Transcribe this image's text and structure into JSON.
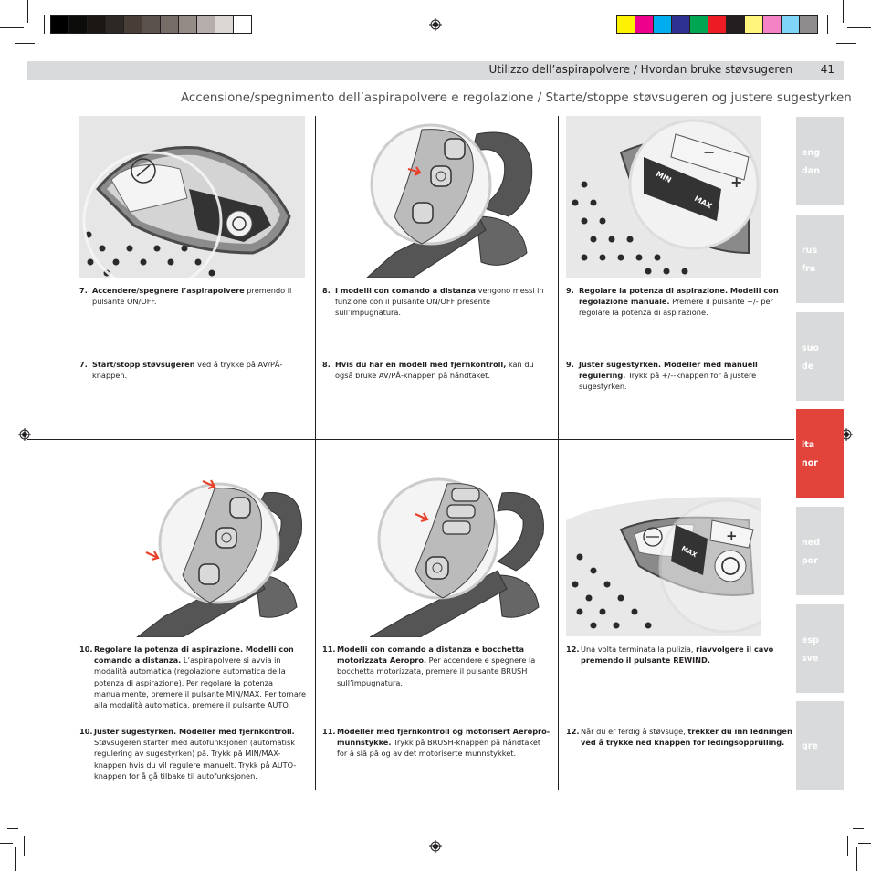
{
  "header": {
    "section_title": "Utilizzo dell’aspirapolvere  /  Hvordan bruke støvsugeren",
    "page_number": "41"
  },
  "page_title": "Accensione/spegnimento dell’aspirapolvere e regolazione  /  Starte/stoppe støvsugeren og justere sugestyrken",
  "print_marks": {
    "grayscale_swatches": [
      "#000000",
      "#0c0d0b",
      "#1b1814",
      "#2c2824",
      "#483d37",
      "#5c524d",
      "#776d68",
      "#958b86",
      "#b5aeac",
      "#d9d6d4",
      "#ffffff"
    ],
    "color_swatches": [
      "#fff200",
      "#ec008c",
      "#00aeef",
      "#2e3192",
      "#00a651",
      "#ed1c24",
      "#231f20",
      "#fff57d",
      "#f383c4",
      "#7fd5f7",
      "#8d8b8b"
    ]
  },
  "steps": [
    {
      "it_num": "7.",
      "it_bold": "Accendere/spegnere l’aspirapolvere",
      "it_text": " premendo il pulsante ON/OFF.",
      "no_num": "7.",
      "no_bold": "Start/stopp støvsugeren",
      "no_text": " ved å trykke på AV/PÅ-knappen.",
      "image": "vacuum-control-panel-onoff"
    },
    {
      "it_num": "8.",
      "it_bold": "I modelli con comando a distanza",
      "it_text": " vengono messi in funzione con il pulsante ON/OFF presente sull’impugnatura.",
      "no_num": "8.",
      "no_bold": "Hvis du har en modell med fjernkontroll,",
      "no_text": " kan du også bruke AV/PÅ-knappen på håndtaket.",
      "image": "handle-remote-onoff"
    },
    {
      "it_num": "9.",
      "it_bold": "Regolare la potenza di aspirazione. Modelli con regolazione manuale.",
      "it_text": " Premere il pulsante +/- per regolare la potenza di aspirazione.",
      "no_num": "9.",
      "no_bold": "Juster sugestyrken. Modeller med manuell regulering.",
      "no_text": " Trykk på +/--knappen for å justere sugestyrken.",
      "image": "control-panel-min-max",
      "panel_labels": [
        "MIN",
        "MAX",
        "−",
        "+"
      ]
    },
    {
      "it_num": "10.",
      "it_bold": "Regolare la potenza di aspirazione. Modelli con comando a distanza.",
      "it_text": " L’aspirapolvere si avvia in modalità automatica (regolazione automatica della potenza di aspirazione). Per regolare la potenza manualmente, premere il pulsante MIN/MAX. Per tornare alla modalità automatica, premere il pulsante AUTO.",
      "no_num": "10.",
      "no_bold": "Juster sugestyrken. Modeller med fjernkontroll.",
      "no_text": " Støvsugeren starter med autofunksjonen (automatisk regulering av sugestyrken) på. Trykk på MIN/MAX-knappen hvis du vil regulere manuelt. Trykk på AUTO-knappen for å gå tilbake til autofunksjonen.",
      "image": "handle-remote-min-max-auto"
    },
    {
      "it_num": "11.",
      "it_bold": "Modelli con comando a distanza e bocchetta motorizzata Aeropro.",
      "it_text": " Per accendere e spegnere la bocchetta motorizzata, premere il pulsante BRUSH sull’impugnatura.",
      "no_num": "11.",
      "no_bold": "Modeller med fjernkontroll og motorisert Aeropro-munnstykke.",
      "no_text": " Trykk på BRUSH-knappen på håndtaket for å slå på og av det motoriserte munnstykket.",
      "image": "handle-remote-brush"
    },
    {
      "it_num": "12.",
      "it_pre": "Una volta terminata la pulizia, ",
      "it_bold": "riavvolgere il cavo premendo il pulsante REWIND.",
      "it_text": "",
      "no_num": "12.",
      "no_pre": "Når du er ferdig å støvsuge, ",
      "no_bold": "trekker du inn ledningen ved å trykke ned knappen for ledingsopprulling.",
      "no_text": "",
      "image": "control-panel-rewind",
      "panel_labels": [
        "MAX",
        "−",
        "+"
      ]
    }
  ],
  "language_tabs": [
    {
      "line1": "eng",
      "line2": "dan",
      "active": false
    },
    {
      "line1": "rus",
      "line2": "fra",
      "active": false
    },
    {
      "line1": "suo",
      "line2": "de",
      "active": false
    },
    {
      "line1": "ita",
      "line2": "nor",
      "active": true
    },
    {
      "line1": "ned",
      "line2": "por",
      "active": false
    },
    {
      "line1": "esp",
      "line2": "sve",
      "active": false
    },
    {
      "line1": "gre",
      "line2": "",
      "active": false
    }
  ],
  "colors": {
    "accent_red": "#e2433a",
    "tab_gray": "#d9dadb",
    "header_gray": "#d9dadb",
    "arrow_red": "#e8412c"
  }
}
